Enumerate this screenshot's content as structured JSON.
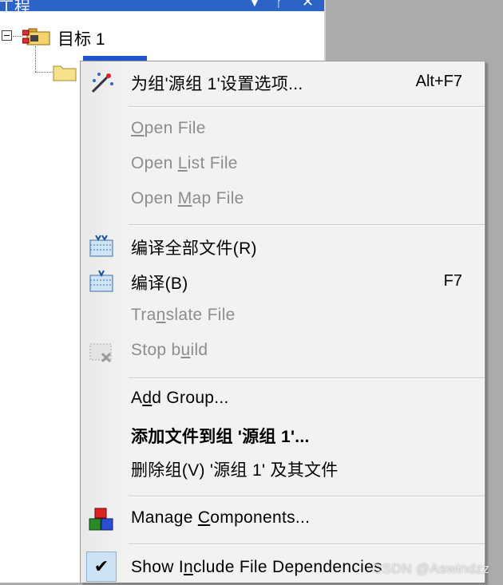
{
  "panel": {
    "title": "工程",
    "header_icons": [
      "chevron-down-icon",
      "pin-icon",
      "close-icon"
    ],
    "pin_glyph": "ᚠ",
    "chevron_glyph": "▼",
    "close_glyph": "✕",
    "target_label": "目标 1"
  },
  "menu": {
    "items": [
      {
        "label": "为组'源组 1'设置选项...",
        "shortcut": "Alt+F7",
        "icon": "options-wand-icon",
        "enabled": true
      },
      {
        "label_pre": "",
        "label_u": "O",
        "label_post": "pen File",
        "enabled": false
      },
      {
        "label_pre": "Open ",
        "label_u": "L",
        "label_post": "ist File",
        "enabled": false
      },
      {
        "label_pre": "Open ",
        "label_u": "M",
        "label_post": "ap File",
        "enabled": false
      },
      {
        "label": "编译全部文件(R)",
        "icon": "rebuild-all-icon",
        "enabled": true
      },
      {
        "label": "编译(B)",
        "shortcut": "F7",
        "icon": "build-icon",
        "enabled": true
      },
      {
        "label_pre": "Tra",
        "label_u": "n",
        "label_post": "slate File",
        "enabled": false
      },
      {
        "label_pre": "Stop b",
        "label_u": "u",
        "label_post": "ild",
        "icon": "stop-build-icon",
        "enabled": false
      },
      {
        "label_pre": "A",
        "label_u": "d",
        "label_post": "d Group...",
        "enabled": true
      },
      {
        "label": "添加文件到组 '源组 1'...",
        "enabled": true,
        "bold": true
      },
      {
        "label": "删除组(V) '源组 1' 及其文件",
        "enabled": true
      },
      {
        "label_pre": "Manage ",
        "label_u": "C",
        "label_post": "omponents...",
        "icon": "components-icon",
        "enabled": true
      },
      {
        "label_pre": "Show I",
        "label_u": "n",
        "label_post": "clude File Dependencies",
        "icon": "check-icon",
        "checked": true,
        "check_glyph": "✔",
        "enabled": true
      }
    ]
  },
  "watermark": "CSDN @Aswindzz",
  "colors": {
    "accent": "#2b63c7",
    "selection": "#1e55c9",
    "disabled_text": "#8d8d8d",
    "menu_bg": "#f2f2f2"
  }
}
